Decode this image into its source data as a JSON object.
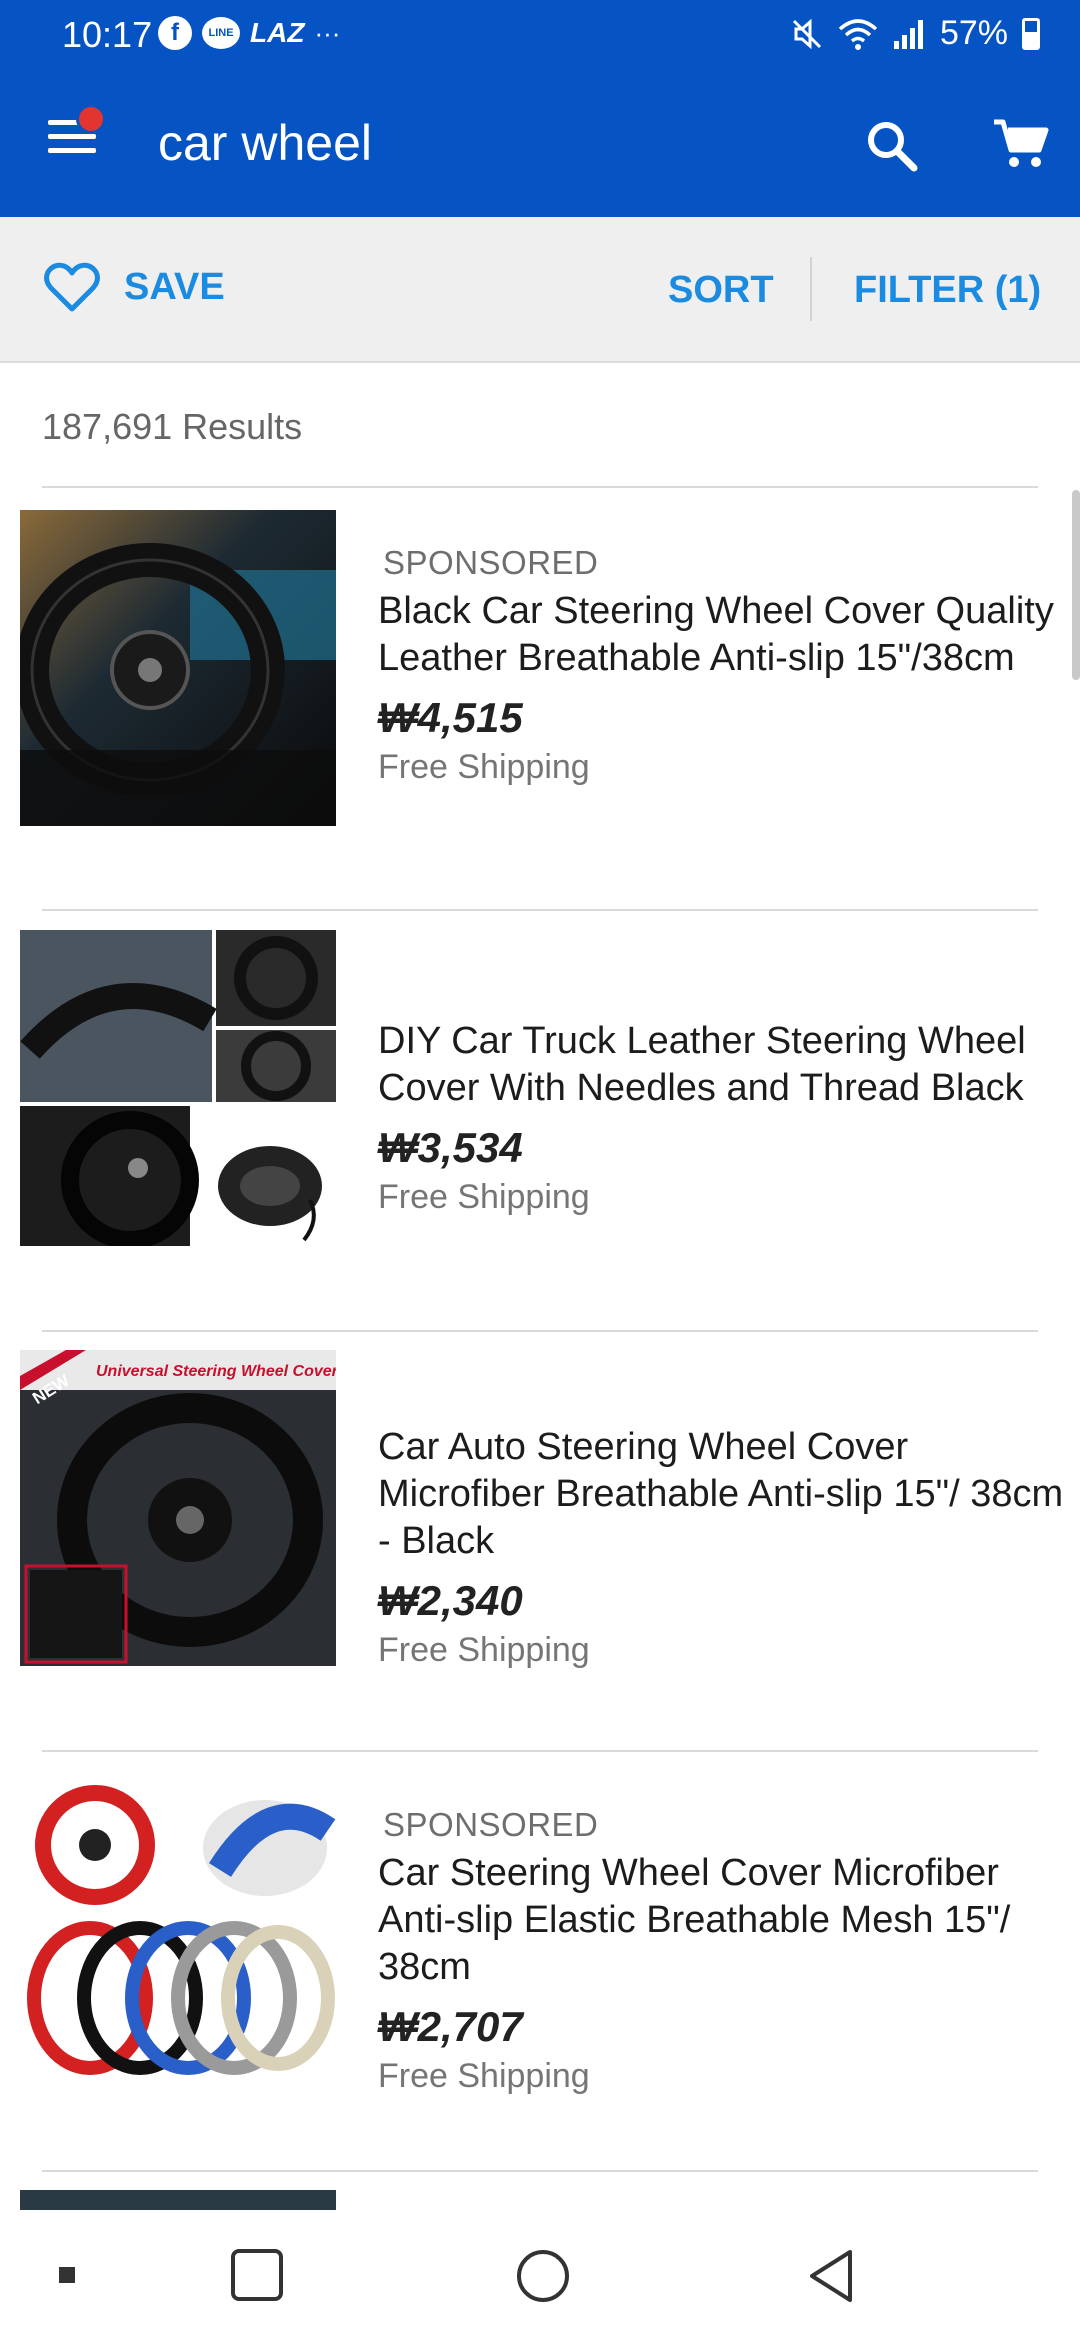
{
  "status_bar": {
    "time": "10:17",
    "icons": [
      "facebook-icon",
      "line-icon",
      "laz-icon",
      "more-notifications-icon"
    ],
    "laz_label": "LAZ",
    "line_label": "LINE",
    "dots": "···",
    "right_icons": [
      "mute-icon",
      "wifi-icon",
      "signal-icon",
      "battery-icon"
    ],
    "battery": "57%"
  },
  "app_bar": {
    "title": "car wheel",
    "color": "#0654c4",
    "icons": [
      "menu-icon",
      "search-icon",
      "cart-icon"
    ]
  },
  "actions": {
    "save_label": "SAVE",
    "sort_label": "SORT",
    "filter_label": "FILTER (1)",
    "accent": "#1a8be0"
  },
  "results": {
    "count_label": "187,691 Results"
  },
  "listings": [
    {
      "sponsored": "SPONSORED",
      "title": "Black Car Steering Wheel Cover Quality Leather Breathable Anti-slip 15\"/38cm",
      "price": "₩4,515",
      "shipping": "Free Shipping"
    },
    {
      "sponsored": "",
      "title": "DIY Car Truck Leather Steering Wheel Cover With Needles and Thread Black",
      "price": "₩3,534",
      "shipping": "Free Shipping"
    },
    {
      "sponsored": "",
      "title": "Car Auto Steering Wheel Cover Microfiber Breathable Anti-slip 15\"/ 38cm - Black",
      "price": "₩2,340",
      "shipping": "Free Shipping",
      "image_text": {
        "badge": "NEW",
        "banner": "Universal Steering Wheel Cover"
      }
    },
    {
      "sponsored": "SPONSORED",
      "title": "Car Steering Wheel Cover Microfiber Anti-slip Elastic Breathable Mesh 15\"/ 38cm",
      "price": "₩2,707",
      "shipping": "Free Shipping"
    }
  ],
  "nav_bar": {
    "icons": [
      "recent-apps-icon",
      "home-icon",
      "back-icon"
    ]
  }
}
